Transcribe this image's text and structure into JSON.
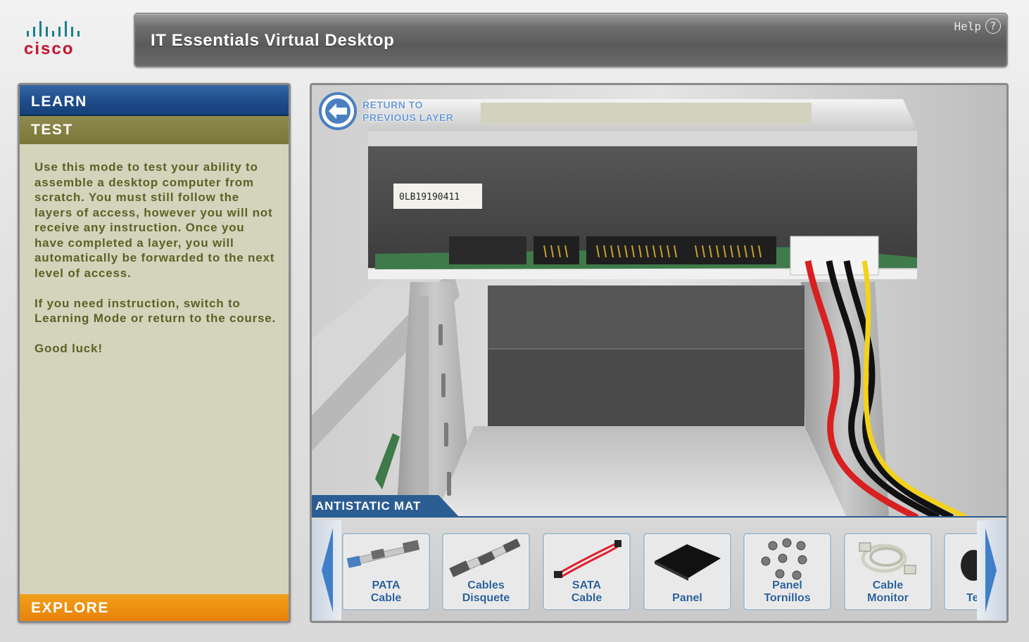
{
  "header": {
    "logo_text": "cisco",
    "app_title": "IT Essentials Virtual Desktop",
    "help_label": "Help",
    "help_icon_glyph": "?"
  },
  "sidebar": {
    "tabs": {
      "learn": "LEARN",
      "test": "TEST",
      "explore": "EXPLORE"
    },
    "description": [
      "Use this mode to test your ability to assemble a desktop computer from scratch. You must still follow the layers of access, however you will not receive any instruction. Once you have completed a layer, you will automatically be forwarded to the next level of access.",
      "If you need instruction, switch to Learning Mode or return to the course.",
      "Good luck!"
    ]
  },
  "viewer": {
    "return_button": {
      "line1": "RETURN TO",
      "line2": "PREVIOUS LAYER"
    },
    "drive_label": "0LB19190411",
    "tray": {
      "title": "ANTISTATIC MAT",
      "items": [
        {
          "line1": "PATA",
          "line2": "Cable",
          "icon": "pata-cable-icon"
        },
        {
          "line1": "Cables",
          "line2": "Disquete",
          "icon": "floppy-cable-icon"
        },
        {
          "line1": "SATA",
          "line2": "Cable",
          "icon": "sata-cable-icon"
        },
        {
          "line1": "",
          "line2": "Panel",
          "icon": "panel-icon"
        },
        {
          "line1": "Panel",
          "line2": "Tornillos",
          "icon": "screws-icon"
        },
        {
          "line1": "Cable",
          "line2": "Monitor",
          "icon": "monitor-cable-icon"
        },
        {
          "line1": "",
          "line2": "Te",
          "icon": "keyboard-icon"
        }
      ]
    }
  },
  "colors": {
    "learn_tab": "#1c4a88",
    "test_tab": "#7a7538",
    "explore_tab": "#e8820a",
    "panel_bg": "#d4d3bb",
    "description_text": "#5c6125",
    "tray_accent": "#2b5d92",
    "cisco_red": "#c8102e",
    "cisco_teal": "#1a7f8e"
  }
}
